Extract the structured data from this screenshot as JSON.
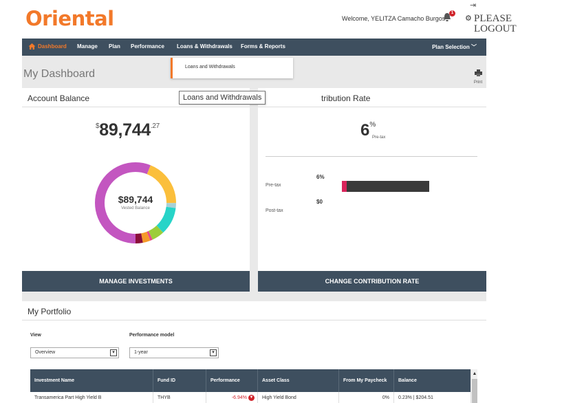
{
  "header": {
    "logo": "Oriental",
    "welcome": "Welcome, YELITZA Camacho Burgos",
    "notification_count": "1",
    "logout": "PLEASE LOGOUT"
  },
  "nav": {
    "items": [
      "Dashboard",
      "Manage",
      "Plan",
      "Performance",
      "Loans & Withdrawals",
      "Forms & Reports"
    ],
    "plan_selection": "Plan Selection"
  },
  "dropdown": {
    "item": "Loans and Withdrawals"
  },
  "tooltip": "Loans and Withdrawals",
  "page": {
    "title": "My Dashboard",
    "print_label": "Print"
  },
  "account_balance": {
    "title": "Account Balance",
    "currency": "$",
    "amount": "89,744",
    "cents": ".27",
    "donut_amount": "$89,744",
    "donut_label": "Vested Balance",
    "button": "MANAGE INVESTMENTS",
    "donut_segments": [
      {
        "color": "#c356c0",
        "share": 0.56
      },
      {
        "color": "#fbbf3c",
        "share": 0.19
      },
      {
        "color": "#a8d0d6",
        "share": 0.02
      },
      {
        "color": "#27d4c8",
        "share": 0.11
      },
      {
        "color": "#9ccd3a",
        "share": 0.05
      },
      {
        "color": "#e84a8a",
        "share": 0.01
      },
      {
        "color": "#f59a2a",
        "share": 0.03
      },
      {
        "color": "#8a0f3a",
        "share": 0.03
      }
    ]
  },
  "contribution": {
    "title_visible": "tribution Rate",
    "percent": "6",
    "percent_sign": "%",
    "sub": "Pre-tax",
    "pretax_label": "Pre-tax",
    "pretax_value": "6%",
    "posttax_label": "Post-tax",
    "posttax_value": "$0",
    "button": "CHANGE CONTRIBUTION RATE"
  },
  "portfolio": {
    "title": "My Portfolio",
    "view_label": "View",
    "view_value": "Overview",
    "model_label": "Performance model",
    "model_value": "1-year",
    "columns": [
      "Investment Name",
      "Fund ID",
      "Performance",
      "Asset Class",
      "From My Paycheck",
      "Balance"
    ],
    "rows": [
      {
        "name": "Transamerica Part High Yield B",
        "fund_id": "THYB",
        "performance": "-6.94%",
        "asset_class": "High Yield Bond",
        "paycheck": "0%",
        "balance": "0.23% | $204.51"
      }
    ]
  },
  "colors": {
    "brand": "#f2792a",
    "nav": "#3e4f5f",
    "negative": "#d0242b"
  }
}
